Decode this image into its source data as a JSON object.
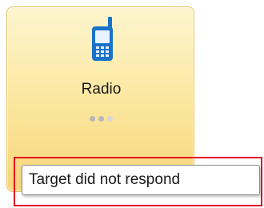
{
  "tile": {
    "label": "Radio",
    "icon": "mobile-phone-icon",
    "page_indicator": {
      "total": 3,
      "active_index": 0
    },
    "colors": {
      "accent": "#1a73c8",
      "background_top": "#fdf5cf",
      "background_bottom": "#f8d57a"
    }
  },
  "tooltip": {
    "text": "Target did not respond"
  },
  "highlight": {
    "color": "#e0141c"
  }
}
